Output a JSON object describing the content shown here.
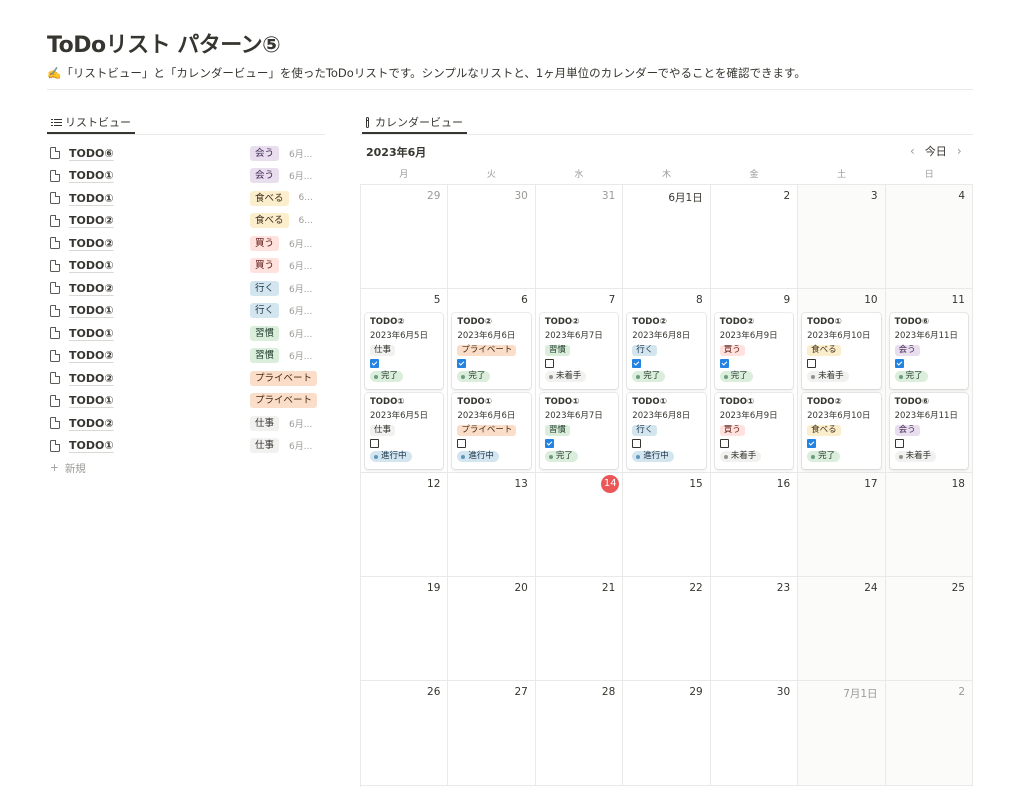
{
  "page": {
    "title": "ToDoリスト パターン⑤",
    "description": "✍️「リストビュー」と「カレンダービュー」を使ったToDoリストです。シンプルなリストと、1ヶ月単位のカレンダーでやることを確認できます。"
  },
  "list_view": {
    "tab_label": "リストビュー",
    "icon": "list-icon",
    "rows": [
      {
        "title": "TODO⑥",
        "tag": "会う",
        "tag_color": "purple",
        "date": "6月..."
      },
      {
        "title": "TODO①",
        "tag": "会う",
        "tag_color": "purple",
        "date": "6月..."
      },
      {
        "title": "TODO①",
        "tag": "食べる",
        "tag_color": "yellow",
        "date": "6..."
      },
      {
        "title": "TODO②",
        "tag": "食べる",
        "tag_color": "yellow",
        "date": "6..."
      },
      {
        "title": "TODO②",
        "tag": "買う",
        "tag_color": "red",
        "date": "6月..."
      },
      {
        "title": "TODO①",
        "tag": "買う",
        "tag_color": "red",
        "date": "6月..."
      },
      {
        "title": "TODO②",
        "tag": "行く",
        "tag_color": "blue",
        "date": "6月..."
      },
      {
        "title": "TODO①",
        "tag": "行く",
        "tag_color": "blue",
        "date": "6月..."
      },
      {
        "title": "TODO①",
        "tag": "習慣",
        "tag_color": "green",
        "date": "6月..."
      },
      {
        "title": "TODO②",
        "tag": "習慣",
        "tag_color": "green",
        "date": "6月..."
      },
      {
        "title": "TODO②",
        "tag": "プライベート",
        "tag_color": "orange",
        "date": ""
      },
      {
        "title": "TODO①",
        "tag": "プライベート",
        "tag_color": "orange",
        "date": ""
      },
      {
        "title": "TODO②",
        "tag": "仕事",
        "tag_color": "gray",
        "date": "6月..."
      },
      {
        "title": "TODO①",
        "tag": "仕事",
        "tag_color": "gray",
        "date": "6月..."
      }
    ],
    "new_label": "新規"
  },
  "calendar_view": {
    "tab_label": "カレンダービュー",
    "icon": "calendar-icon",
    "month_label": "2023年6月",
    "today_label": "今日",
    "weekdays": [
      "月",
      "火",
      "水",
      "木",
      "金",
      "土",
      "日"
    ],
    "weeks": [
      [
        {
          "day": "29",
          "muted": true,
          "cards": []
        },
        {
          "day": "30",
          "muted": true,
          "cards": []
        },
        {
          "day": "31",
          "muted": true,
          "cards": []
        },
        {
          "day": "6月1日",
          "cards": []
        },
        {
          "day": "2",
          "cards": []
        },
        {
          "day": "3",
          "weekend": true,
          "cards": []
        },
        {
          "day": "4",
          "weekend": true,
          "cards": []
        }
      ],
      [
        {
          "day": "5",
          "cards": [
            {
              "title": "TODO②",
              "date": "2023年6月5日",
              "tag": "仕事",
              "tag_color": "gray",
              "checked": true,
              "status": "完了",
              "status_type": "done"
            },
            {
              "title": "TODO①",
              "date": "2023年6月5日",
              "tag": "仕事",
              "tag_color": "gray",
              "checked": false,
              "status": "進行中",
              "status_type": "prog"
            }
          ]
        },
        {
          "day": "6",
          "cards": [
            {
              "title": "TODO②",
              "date": "2023年6月6日",
              "tag": "プライベート",
              "tag_color": "orange",
              "checked": true,
              "status": "完了",
              "status_type": "done"
            },
            {
              "title": "TODO①",
              "date": "2023年6月6日",
              "tag": "プライベート",
              "tag_color": "orange",
              "checked": false,
              "status": "進行中",
              "status_type": "prog"
            }
          ]
        },
        {
          "day": "7",
          "cards": [
            {
              "title": "TODO②",
              "date": "2023年6月7日",
              "tag": "習慣",
              "tag_color": "green",
              "checked": false,
              "status": "未着手",
              "status_type": "todo"
            },
            {
              "title": "TODO①",
              "date": "2023年6月7日",
              "tag": "習慣",
              "tag_color": "green",
              "checked": true,
              "status": "完了",
              "status_type": "done"
            }
          ]
        },
        {
          "day": "8",
          "cards": [
            {
              "title": "TODO②",
              "date": "2023年6月8日",
              "tag": "行く",
              "tag_color": "blue",
              "checked": true,
              "status": "完了",
              "status_type": "done"
            },
            {
              "title": "TODO①",
              "date": "2023年6月8日",
              "tag": "行く",
              "tag_color": "blue",
              "checked": false,
              "status": "進行中",
              "status_type": "prog"
            }
          ]
        },
        {
          "day": "9",
          "cards": [
            {
              "title": "TODO②",
              "date": "2023年6月9日",
              "tag": "買う",
              "tag_color": "red",
              "checked": true,
              "status": "完了",
              "status_type": "done"
            },
            {
              "title": "TODO①",
              "date": "2023年6月9日",
              "tag": "買う",
              "tag_color": "red",
              "checked": false,
              "status": "未着手",
              "status_type": "todo"
            }
          ]
        },
        {
          "day": "10",
          "weekend": true,
          "cards": [
            {
              "title": "TODO①",
              "date": "2023年6月10日",
              "tag": "食べる",
              "tag_color": "yellow",
              "checked": false,
              "status": "未着手",
              "status_type": "todo"
            },
            {
              "title": "TODO②",
              "date": "2023年6月10日",
              "tag": "食べる",
              "tag_color": "yellow",
              "checked": true,
              "status": "完了",
              "status_type": "done"
            }
          ]
        },
        {
          "day": "11",
          "weekend": true,
          "cards": [
            {
              "title": "TODO⑥",
              "date": "2023年6月11日",
              "tag": "会う",
              "tag_color": "purple",
              "checked": true,
              "status": "完了",
              "status_type": "done"
            },
            {
              "title": "TODO⑥",
              "date": "2023年6月11日",
              "tag": "会う",
              "tag_color": "purple",
              "checked": false,
              "status": "未着手",
              "status_type": "todo"
            }
          ]
        }
      ],
      [
        {
          "day": "12",
          "cards": []
        },
        {
          "day": "13",
          "cards": []
        },
        {
          "day": "14",
          "today": true,
          "cards": []
        },
        {
          "day": "15",
          "cards": []
        },
        {
          "day": "16",
          "cards": []
        },
        {
          "day": "17",
          "weekend": true,
          "cards": []
        },
        {
          "day": "18",
          "weekend": true,
          "cards": []
        }
      ],
      [
        {
          "day": "19",
          "cards": []
        },
        {
          "day": "20",
          "cards": []
        },
        {
          "day": "21",
          "cards": []
        },
        {
          "day": "22",
          "cards": []
        },
        {
          "day": "23",
          "cards": []
        },
        {
          "day": "24",
          "weekend": true,
          "cards": []
        },
        {
          "day": "25",
          "weekend": true,
          "cards": []
        }
      ],
      [
        {
          "day": "26",
          "cards": []
        },
        {
          "day": "27",
          "cards": []
        },
        {
          "day": "28",
          "cards": []
        },
        {
          "day": "29",
          "cards": []
        },
        {
          "day": "30",
          "cards": []
        },
        {
          "day": "7月1日",
          "muted": true,
          "weekend": true,
          "cards": []
        },
        {
          "day": "2",
          "muted": true,
          "weekend": true,
          "cards": []
        }
      ]
    ]
  }
}
